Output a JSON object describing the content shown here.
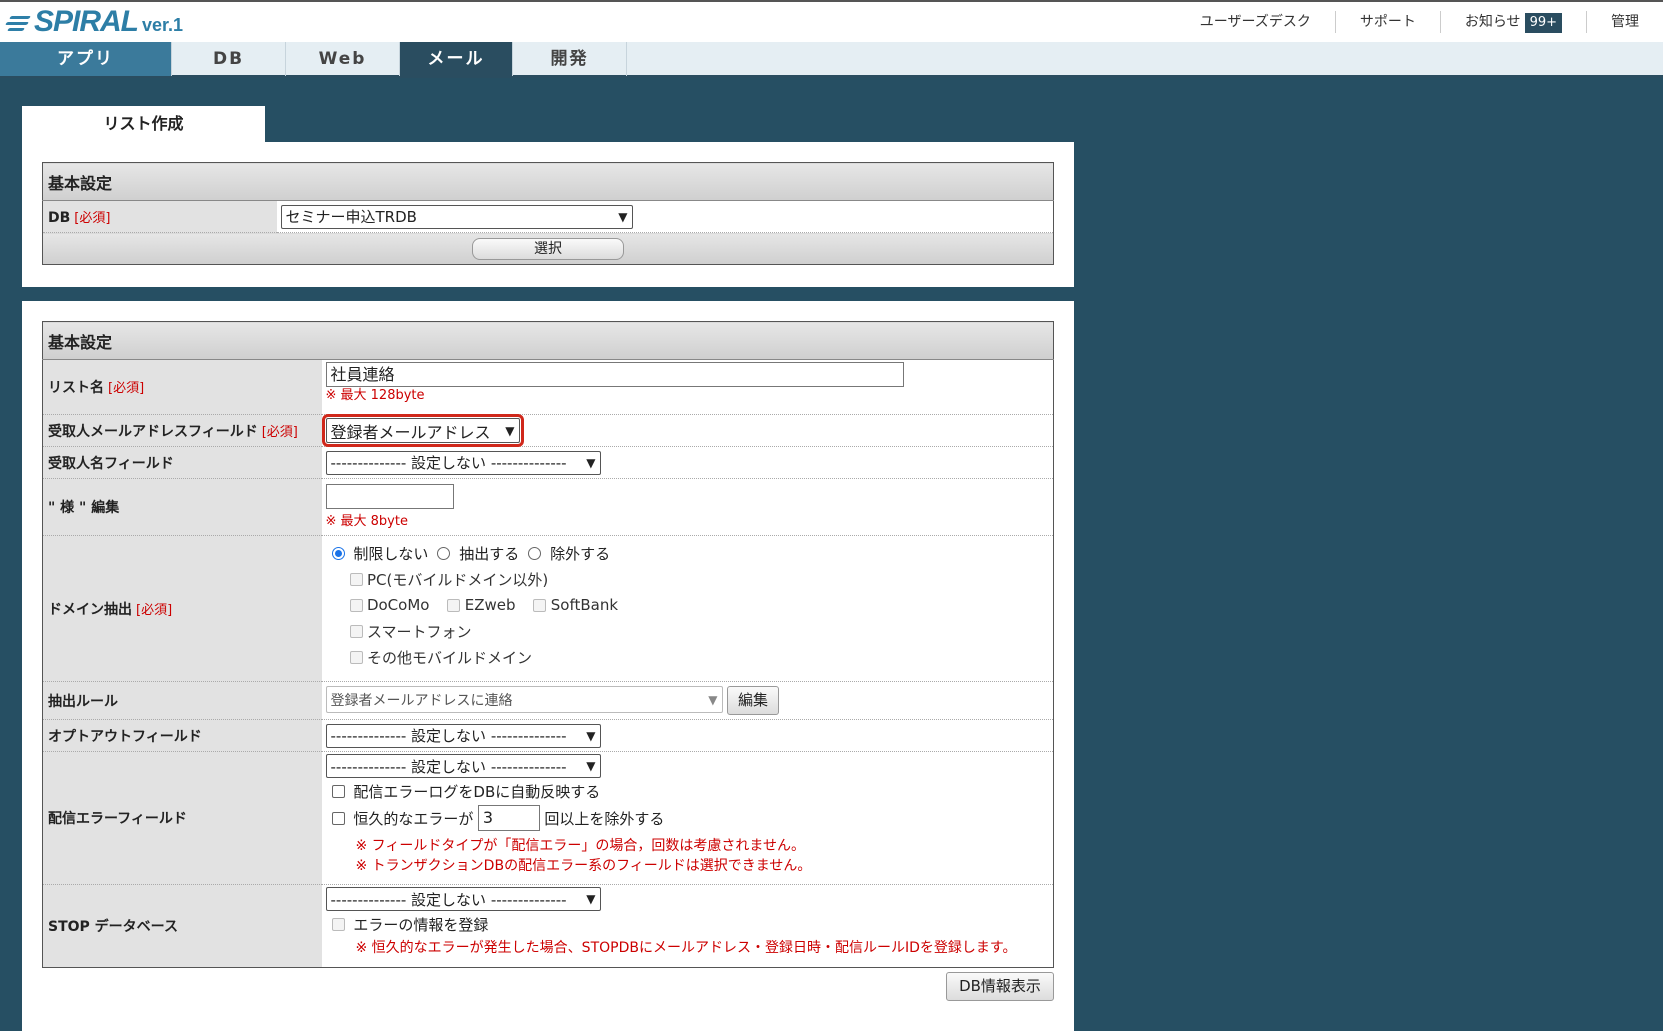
{
  "header": {
    "logo_text": "SPIRAL",
    "logo_version": "ver.1",
    "links": [
      "ユーザーズデスク",
      "サポート",
      "お知らせ",
      "管理"
    ],
    "notification_badge": "99+"
  },
  "nav": {
    "tabs": [
      "アプリ",
      "DB",
      "Web",
      "メール",
      "開発"
    ]
  },
  "page_tab": "リスト作成",
  "panel1": {
    "section_title": "基本設定",
    "db_label": "DB",
    "required": "[必須]",
    "db_value": "セミナー申込TRDB",
    "select_button": "選択"
  },
  "panel2": {
    "section_title": "基本設定",
    "list_name_label": "リスト名",
    "list_name_value": "社員連絡",
    "list_name_note": "※ 最大 128byte",
    "recipient_mail_label": "受取人メールアドレスフィールド",
    "recipient_mail_value": "登録者メールアドレス",
    "recipient_name_label": "受取人名フィールド",
    "not_set": "-------------- 設定しない --------------",
    "sama_label": "\" 様 \" 編集",
    "sama_value": "",
    "sama_note": "※ 最大 8byte",
    "domain_label": "ドメイン抽出",
    "domain_radios": [
      "制限しない",
      "抽出する",
      "除外する"
    ],
    "domain_pc": "PC(モバイルドメイン以外)",
    "domain_docomo": "DoCoMo",
    "domain_ezweb": "EZweb",
    "domain_softbank": "SoftBank",
    "domain_smartphone": "スマートフォン",
    "domain_other": "その他モバイルドメイン",
    "rule_label": "抽出ルール",
    "rule_value": "登録者メールアドレスに連絡",
    "rule_edit": "編集",
    "optout_label": "オプトアウトフィールド",
    "error_label": "配信エラーフィールド",
    "error_auto": "配信エラーログをDBに自動反映する",
    "error_perm_prefix": "恒久的なエラーが",
    "error_perm_count": "3",
    "error_perm_suffix": "回以上を除外する",
    "error_note1": "※ フィールドタイプが「配信エラー」の場合，回数は考慮されません。",
    "error_note2": "※ トランザクションDBの配信エラー系のフィールドは選択できません。",
    "stop_label": "STOP データベース",
    "stop_register": "エラーの情報を登録",
    "stop_note": "※ 恒久的なエラーが発生した場合、STOPDBにメールアドレス・登録日時・配信ルールIDを登録します。",
    "db_info_button": "DB情報表示"
  },
  "colors": {
    "background": "#264f63",
    "nav_active": "#2a4d60",
    "required_red": "#cc0000",
    "highlight": "#d0281b"
  }
}
